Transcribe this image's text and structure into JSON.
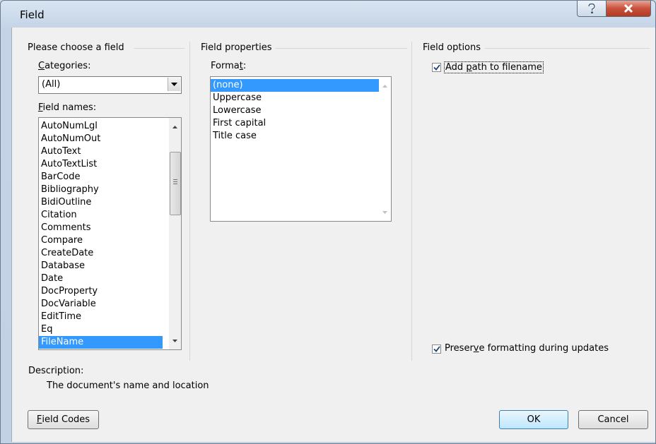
{
  "window": {
    "title": "Field"
  },
  "choose": {
    "heading": "Please choose a field",
    "categories_label_u": "C",
    "categories_label_rest": "ategories:",
    "categories_value": "(All)",
    "fieldnames_label_u": "F",
    "fieldnames_label_rest": "ield names:",
    "field_names": [
      "AutoNumLgl",
      "AutoNumOut",
      "AutoText",
      "AutoTextList",
      "BarCode",
      "Bibliography",
      "BidiOutline",
      "Citation",
      "Comments",
      "Compare",
      "CreateDate",
      "Database",
      "Date",
      "DocProperty",
      "DocVariable",
      "EditTime",
      "Eq",
      "FileName"
    ],
    "selected_field": "FileName"
  },
  "properties": {
    "heading": "Field properties",
    "format_label_pre": "Forma",
    "format_label_u": "t",
    "format_label_post": ":",
    "formats": [
      "(none)",
      "Uppercase",
      "Lowercase",
      "First capital",
      "Title case"
    ],
    "selected_format": "(none)"
  },
  "options": {
    "heading": "Field options",
    "add_path_pre": "Add ",
    "add_path_u": "p",
    "add_path_post": "ath to filename",
    "add_path_checked": true,
    "preserve_pre": "Preser",
    "preserve_u": "v",
    "preserve_post": "e formatting during updates",
    "preserve_checked": true
  },
  "description": {
    "label": "Description:",
    "text": "The document's name and location"
  },
  "buttons": {
    "field_codes_u": "F",
    "field_codes_rest": "ield Codes",
    "ok": "OK",
    "cancel": "Cancel"
  }
}
